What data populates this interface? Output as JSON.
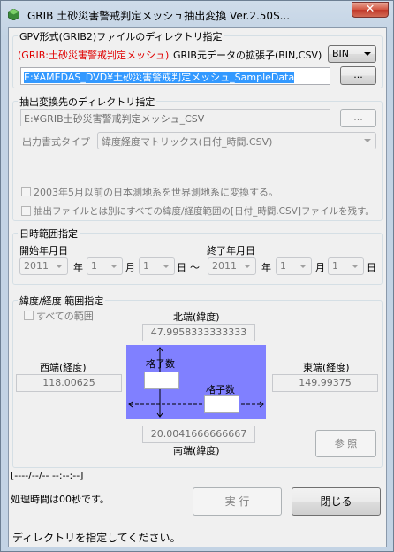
{
  "window": {
    "title": "GRIB 土砂災害警戒判定メッシュ抽出変換 Ver.2.50S...",
    "close_glyph": "✕"
  },
  "source_group": {
    "label": "GPV形式(GRIB2)ファイルのディレクトリ指定",
    "note": "(GRIB:土砂災害警戒判定メッシュ)",
    "ext_label": "GRIB元データの拡張子(BIN,CSV)",
    "ext_value": "BIN",
    "path": "E:¥AMEDAS_DVD¥土砂災害警戒判定メッシュ_SampleData",
    "browse_label": "..."
  },
  "dest_group": {
    "label": "抽出変換先のディレクトリ指定",
    "path": "E:¥GRIB土砂災害警戒判定メッシュ_CSV",
    "browse_label": "...",
    "format_label": "出力書式タイプ",
    "format_value": "緯度経度マトリックス(日付_時間.CSV)",
    "check_datum": "2003年5月以前の日本測地系を世界測地系に変換する。",
    "check_latlon": "抽出ファイルとは別にすべての緯度/経度範囲の[日付_時間.CSV]ファイルを残す。"
  },
  "date_group": {
    "label": "日時範囲指定",
    "start_label": "開始年月日",
    "end_label": "終了年月日",
    "start": {
      "year": "2011",
      "month": "1",
      "day": "1"
    },
    "end": {
      "year": "2011",
      "month": "1",
      "day": "1"
    },
    "year_unit": "年",
    "month_unit": "月",
    "day_unit": "日",
    "tilde": "〜"
  },
  "range_group": {
    "label": "緯度/経度 範囲指定",
    "all_range": "すべての範囲",
    "north_label": "北端(緯度)",
    "north_value": "47.9958333333333",
    "south_label": "南端(緯度)",
    "south_value": "20.0041666666667",
    "west_label": "西端(経度)",
    "west_value": "118.00625",
    "east_label": "東端(経度)",
    "east_value": "149.99375",
    "grid_label_v": "格子数",
    "grid_label_h": "格子数",
    "browse_ref": "参 照",
    "map_color": "#8080ff"
  },
  "footer": {
    "progress": "[----/--/-- --:--:--]",
    "elapsed": "処理時間は00秒です。",
    "run_label": "実 行",
    "close_label": "閉じる"
  },
  "status": {
    "text": "ディレクトリを指定してください。"
  }
}
